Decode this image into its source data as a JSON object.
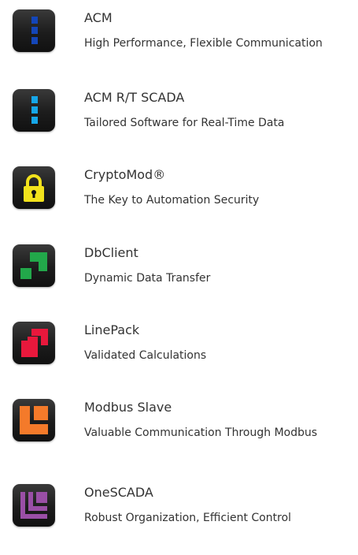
{
  "products": [
    {
      "name": "ACM",
      "tagline": "High Performance, Flexible Communication",
      "icon": "acm-blocks-icon",
      "color": "#1446b8"
    },
    {
      "name": "ACM R/T SCADA",
      "tagline": "Tailored Software for Real-Time Data",
      "icon": "acm-rt-scada-blocks-icon",
      "color": "#16a6e8"
    },
    {
      "name": "CryptoMod®",
      "tagline": "The Key to Automation Security",
      "icon": "padlock-icon",
      "color": "#f2e21c"
    },
    {
      "name": "DbClient",
      "tagline": "Dynamic Data Transfer",
      "icon": "dbclient-squares-icon",
      "color": "#22a84a"
    },
    {
      "name": "LinePack",
      "tagline": "Validated Calculations",
      "icon": "linepack-squares-icon",
      "color": "#e8183c"
    },
    {
      "name": "Modbus Slave",
      "tagline": "Valuable Communication Through Modbus",
      "icon": "modbus-slave-l-shape-icon",
      "color": "#f47a2a"
    },
    {
      "name": "OneSCADA",
      "tagline": "Robust Organization, Efficient Control",
      "icon": "onescada-l-shapes-icon",
      "color": "#9a4fa6"
    }
  ]
}
